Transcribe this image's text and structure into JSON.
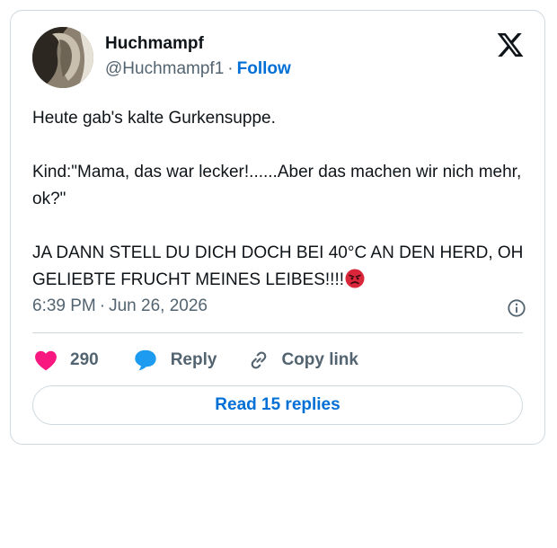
{
  "author": {
    "display_name": "Huchmampf",
    "handle": "@Huchmampf1",
    "separator": "·",
    "follow_label": "Follow",
    "avatar_icon": "profile-photo"
  },
  "brand": {
    "logo_icon": "x-logo-icon"
  },
  "tweet": {
    "line1": "Heute gab's kalte Gurkensuppe.",
    "line2": "Kind:\"Mama, das war lecker!......Aber das machen wir nich mehr, ok?\"",
    "line3": "JA DANN STELL DU DICH DOCH BEI 40°C AN DEN HERD, OH GELIEBTE FRUCHT MEINES LEIBES!!!!",
    "emoji": "angry-face"
  },
  "meta": {
    "time": "6:39 PM",
    "separator": "·",
    "date": "Jun 26, 2026",
    "info_icon": "info-icon"
  },
  "actions": {
    "like_count": "290",
    "reply_label": "Reply",
    "copy_label": "Copy link"
  },
  "read_replies_label": "Read 15 replies",
  "colors": {
    "link": "#006fd6",
    "like": "#f91880",
    "secondary_text": "#536471",
    "border": "#cfd9de"
  }
}
